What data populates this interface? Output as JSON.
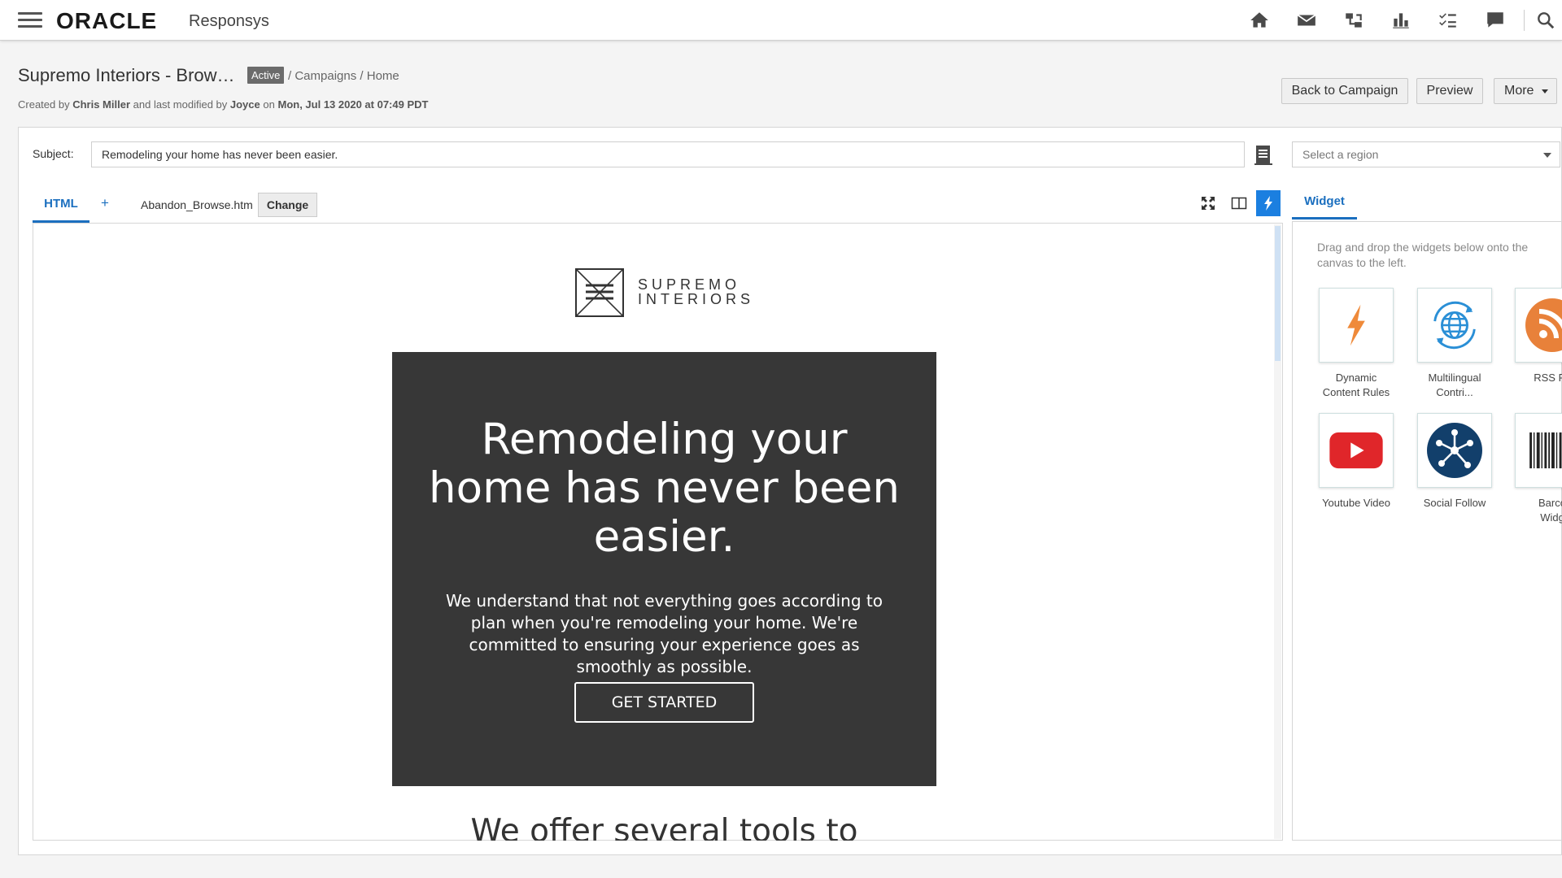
{
  "app": {
    "brand": "ORACLE",
    "product": "Responsys"
  },
  "topbar": {
    "icons": [
      "home-icon",
      "mail-icon",
      "program-icon",
      "insights-icon",
      "tasks-icon",
      "chat-icon",
      "search-icon"
    ]
  },
  "header": {
    "title": "Supremo Interiors - Brow…",
    "status_badge": "Active",
    "breadcrumb": [
      "Campaigns",
      "Home"
    ],
    "breadcrumb_sep": "/",
    "meta": {
      "created_by_label": "Created by",
      "created_by": "Chris Miller",
      "modified_label": "and last modified by",
      "modified_by": "Joyce",
      "on_label": "on",
      "date": "Mon, Jul 13 2020 at 07:49 PDT"
    },
    "buttons": {
      "back": "Back to Campaign",
      "preview": "Preview",
      "more": "More"
    }
  },
  "subject": {
    "label": "Subject:",
    "value": "Remodeling your home has never been easier."
  },
  "region": {
    "placeholder": "Select a region"
  },
  "editor": {
    "tab": "HTML",
    "add": "+",
    "filename": "Abandon_Browse.htm",
    "change": "Change"
  },
  "email": {
    "logo_line1": "SUPREMO",
    "logo_line2": "INTERIORS",
    "hero_title": "Remodeling your home has never been easier.",
    "hero_body": "We understand that not everything goes according to plan when you're remodeling your home. We're committed to ensuring your experience goes as smoothly as possible.",
    "cta": "GET STARTED",
    "next_heading": "We offer several tools to"
  },
  "widgets": {
    "tab": "Widget",
    "help": "Drag and drop the widgets below onto the canvas to the left.",
    "items": [
      {
        "label": "Dynamic Content Rules",
        "icon": "lightning-icon"
      },
      {
        "label": "Multilingual Contri...",
        "icon": "globe-icon"
      },
      {
        "label": "RSS Fe",
        "icon": "rss-icon"
      },
      {
        "label": "Youtube Video",
        "icon": "youtube-icon"
      },
      {
        "label": "Social Follow",
        "icon": "social-follow-icon"
      },
      {
        "label": "Barco Widg",
        "icon": "barcode-icon"
      }
    ]
  },
  "colors": {
    "accent": "#1b6fbf",
    "hero_bg": "#373737",
    "active_tool": "#1b7fe0",
    "rss": "#e8813a",
    "youtube": "#e0262a",
    "social": "#123f6b"
  }
}
